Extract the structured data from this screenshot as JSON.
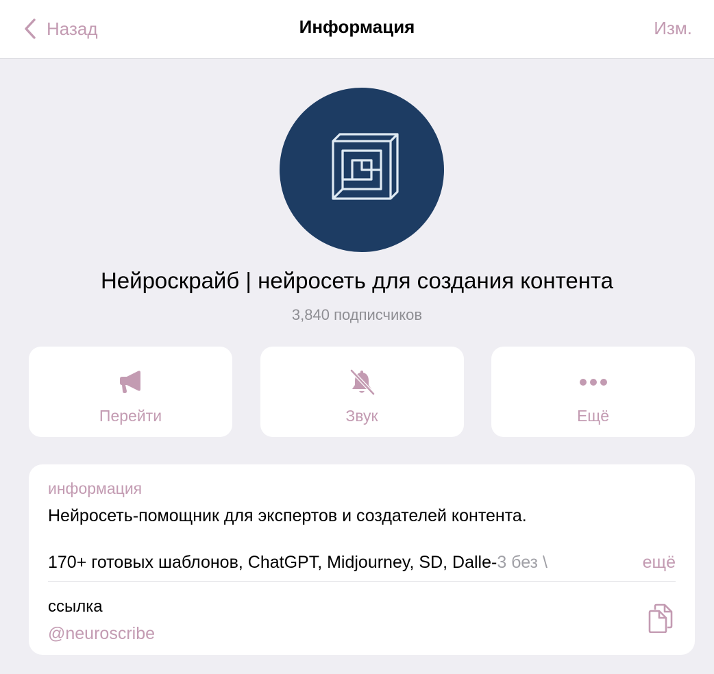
{
  "nav": {
    "back_label": "Назад",
    "title": "Информация",
    "edit_label": "Изм."
  },
  "channel": {
    "name": "Нейроскрайб | нейросеть для создания контента",
    "subscribers": "3,840 подписчиков"
  },
  "actions": [
    {
      "label": "Перейти",
      "icon": "megaphone-icon"
    },
    {
      "label": "Звук",
      "icon": "bell-muted-icon"
    },
    {
      "label": "Ещё",
      "icon": "more-dots-icon"
    }
  ],
  "info": {
    "section_label": "информация",
    "description_line1": "Нейросеть-помощник для экспертов и создателей контента.",
    "description_line2": "170+ готовых шаблонов, ChatGPT, Midjourney, SD, Dalle-",
    "description_line2_fade": "3 без \\",
    "more_label": "ещё",
    "link_label": "ссылка",
    "link_value": "@neuroscribe"
  },
  "colors": {
    "accent": "#c39bb2",
    "background": "#efeef3",
    "avatar_bg": "#1d3c63"
  }
}
